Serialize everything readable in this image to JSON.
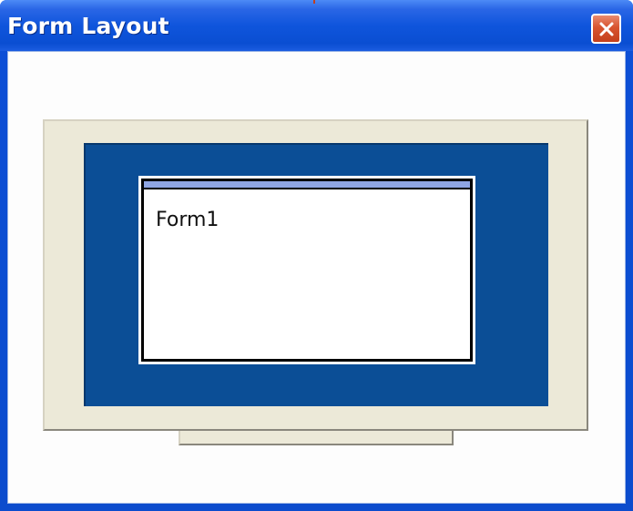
{
  "window": {
    "title": "Form Layout",
    "close_icon": "close-icon"
  },
  "preview": {
    "form_caption": "Form1"
  },
  "colors": {
    "titlebar": "#0a4ed2",
    "screen": "#0b4e96",
    "monitor_frame": "#ece9d8",
    "form_titlebar": "#8fa5e3",
    "close_button": "#d8542f"
  }
}
